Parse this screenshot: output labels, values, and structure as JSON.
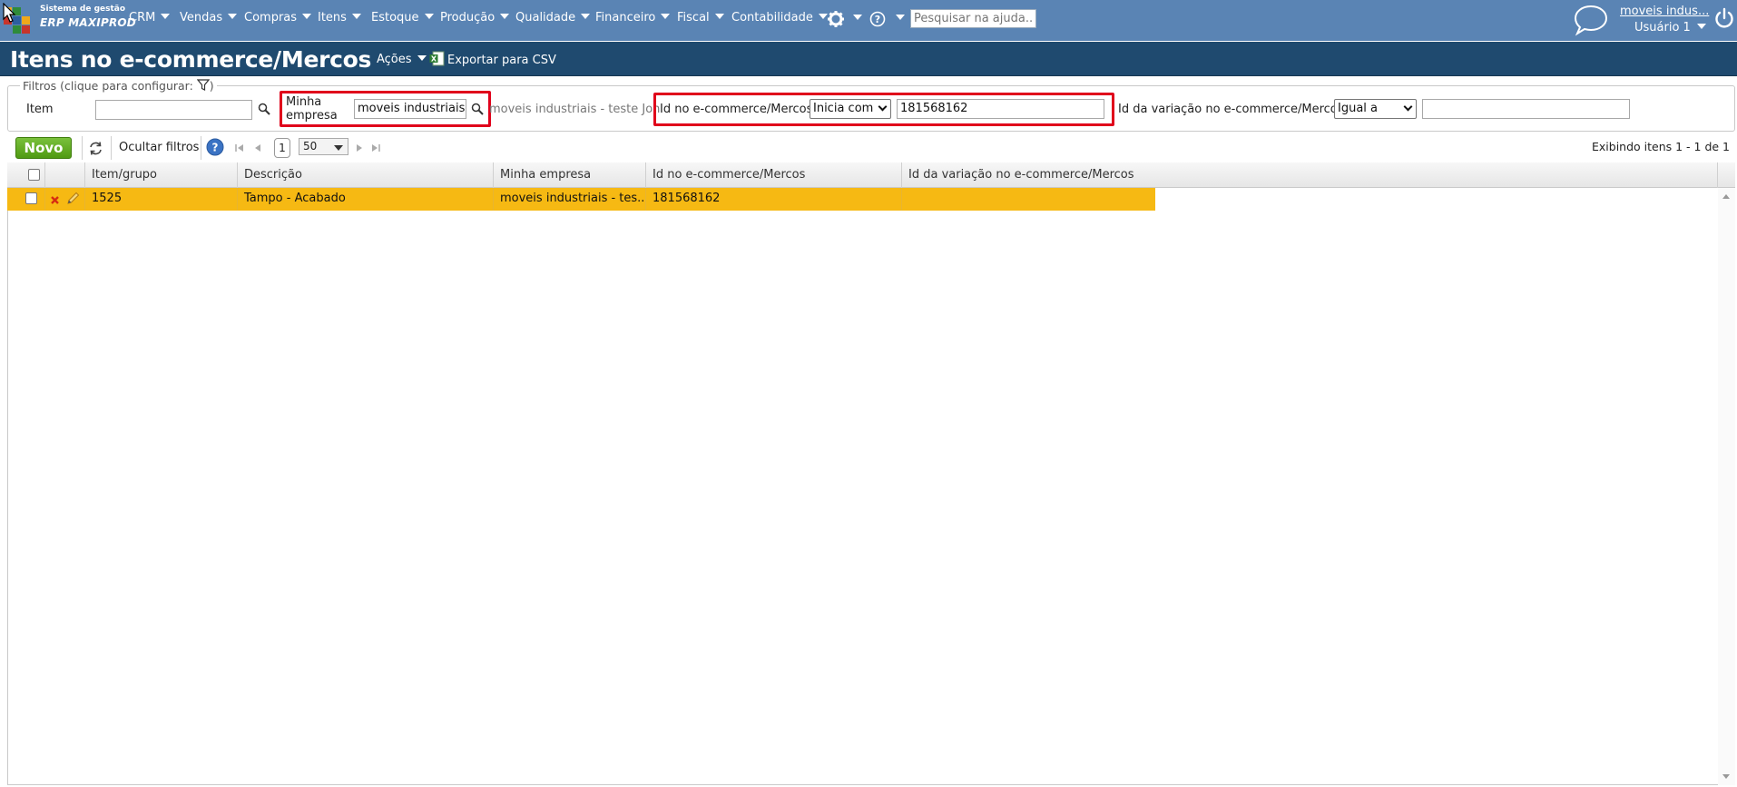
{
  "app": {
    "logo_line1": "Sistema de gestão",
    "logo_line2": "ERP MAXIPROD"
  },
  "nav": {
    "items": [
      "CRM",
      "Vendas",
      "Compras",
      "Itens",
      "Estoque",
      "Produção",
      "Qualidade",
      "Financeiro",
      "Fiscal",
      "Contabilidade"
    ],
    "search_placeholder": "Pesquisar na ajuda...",
    "company_link": "moveis indus...",
    "user": "Usuário 1"
  },
  "title_bar": {
    "title": "Itens no e-commerce/Mercos",
    "actions_label": "Ações",
    "export_label": "Exportar para CSV"
  },
  "filters": {
    "legend": "Filtros (clique para configurar:",
    "legend_close": ")",
    "item_label": "Item",
    "item_value": "",
    "empresa_label_1": "Minha",
    "empresa_label_2": "empresa",
    "empresa_value": "moveis industriais - teste Jon",
    "empresa_text": "moveis industriais - teste Jon",
    "id_label": "Id no e-commerce/Mercos",
    "id_operator": "Inicia com",
    "id_value": "181568162",
    "var_label": "Id da variação no e-commerce/Mercos",
    "var_operator": "Igual a",
    "var_value": ""
  },
  "toolbar": {
    "new_label": "Novo",
    "hide_filters_label": "Ocultar filtros",
    "page": "1",
    "page_size": "50",
    "showing": "Exibindo itens 1 - 1 de 1"
  },
  "grid": {
    "columns": [
      "Item/grupo",
      "Descrição",
      "Minha empresa",
      "Id no e-commerce/Mercos",
      "Id da variação no e-commerce/Mercos"
    ],
    "rows": [
      {
        "item": "1525",
        "descricao": "Tampo - Acabado",
        "empresa": "moveis industriais - tes...",
        "id_mercos": "181568162",
        "id_variacao": ""
      }
    ]
  },
  "colors": {
    "nav_bg": "#5a84b4",
    "title_bg": "#1f4a6f",
    "selected_row": "#f6b913",
    "new_button": "#5ca71c",
    "highlight_box": "#e0001b"
  }
}
